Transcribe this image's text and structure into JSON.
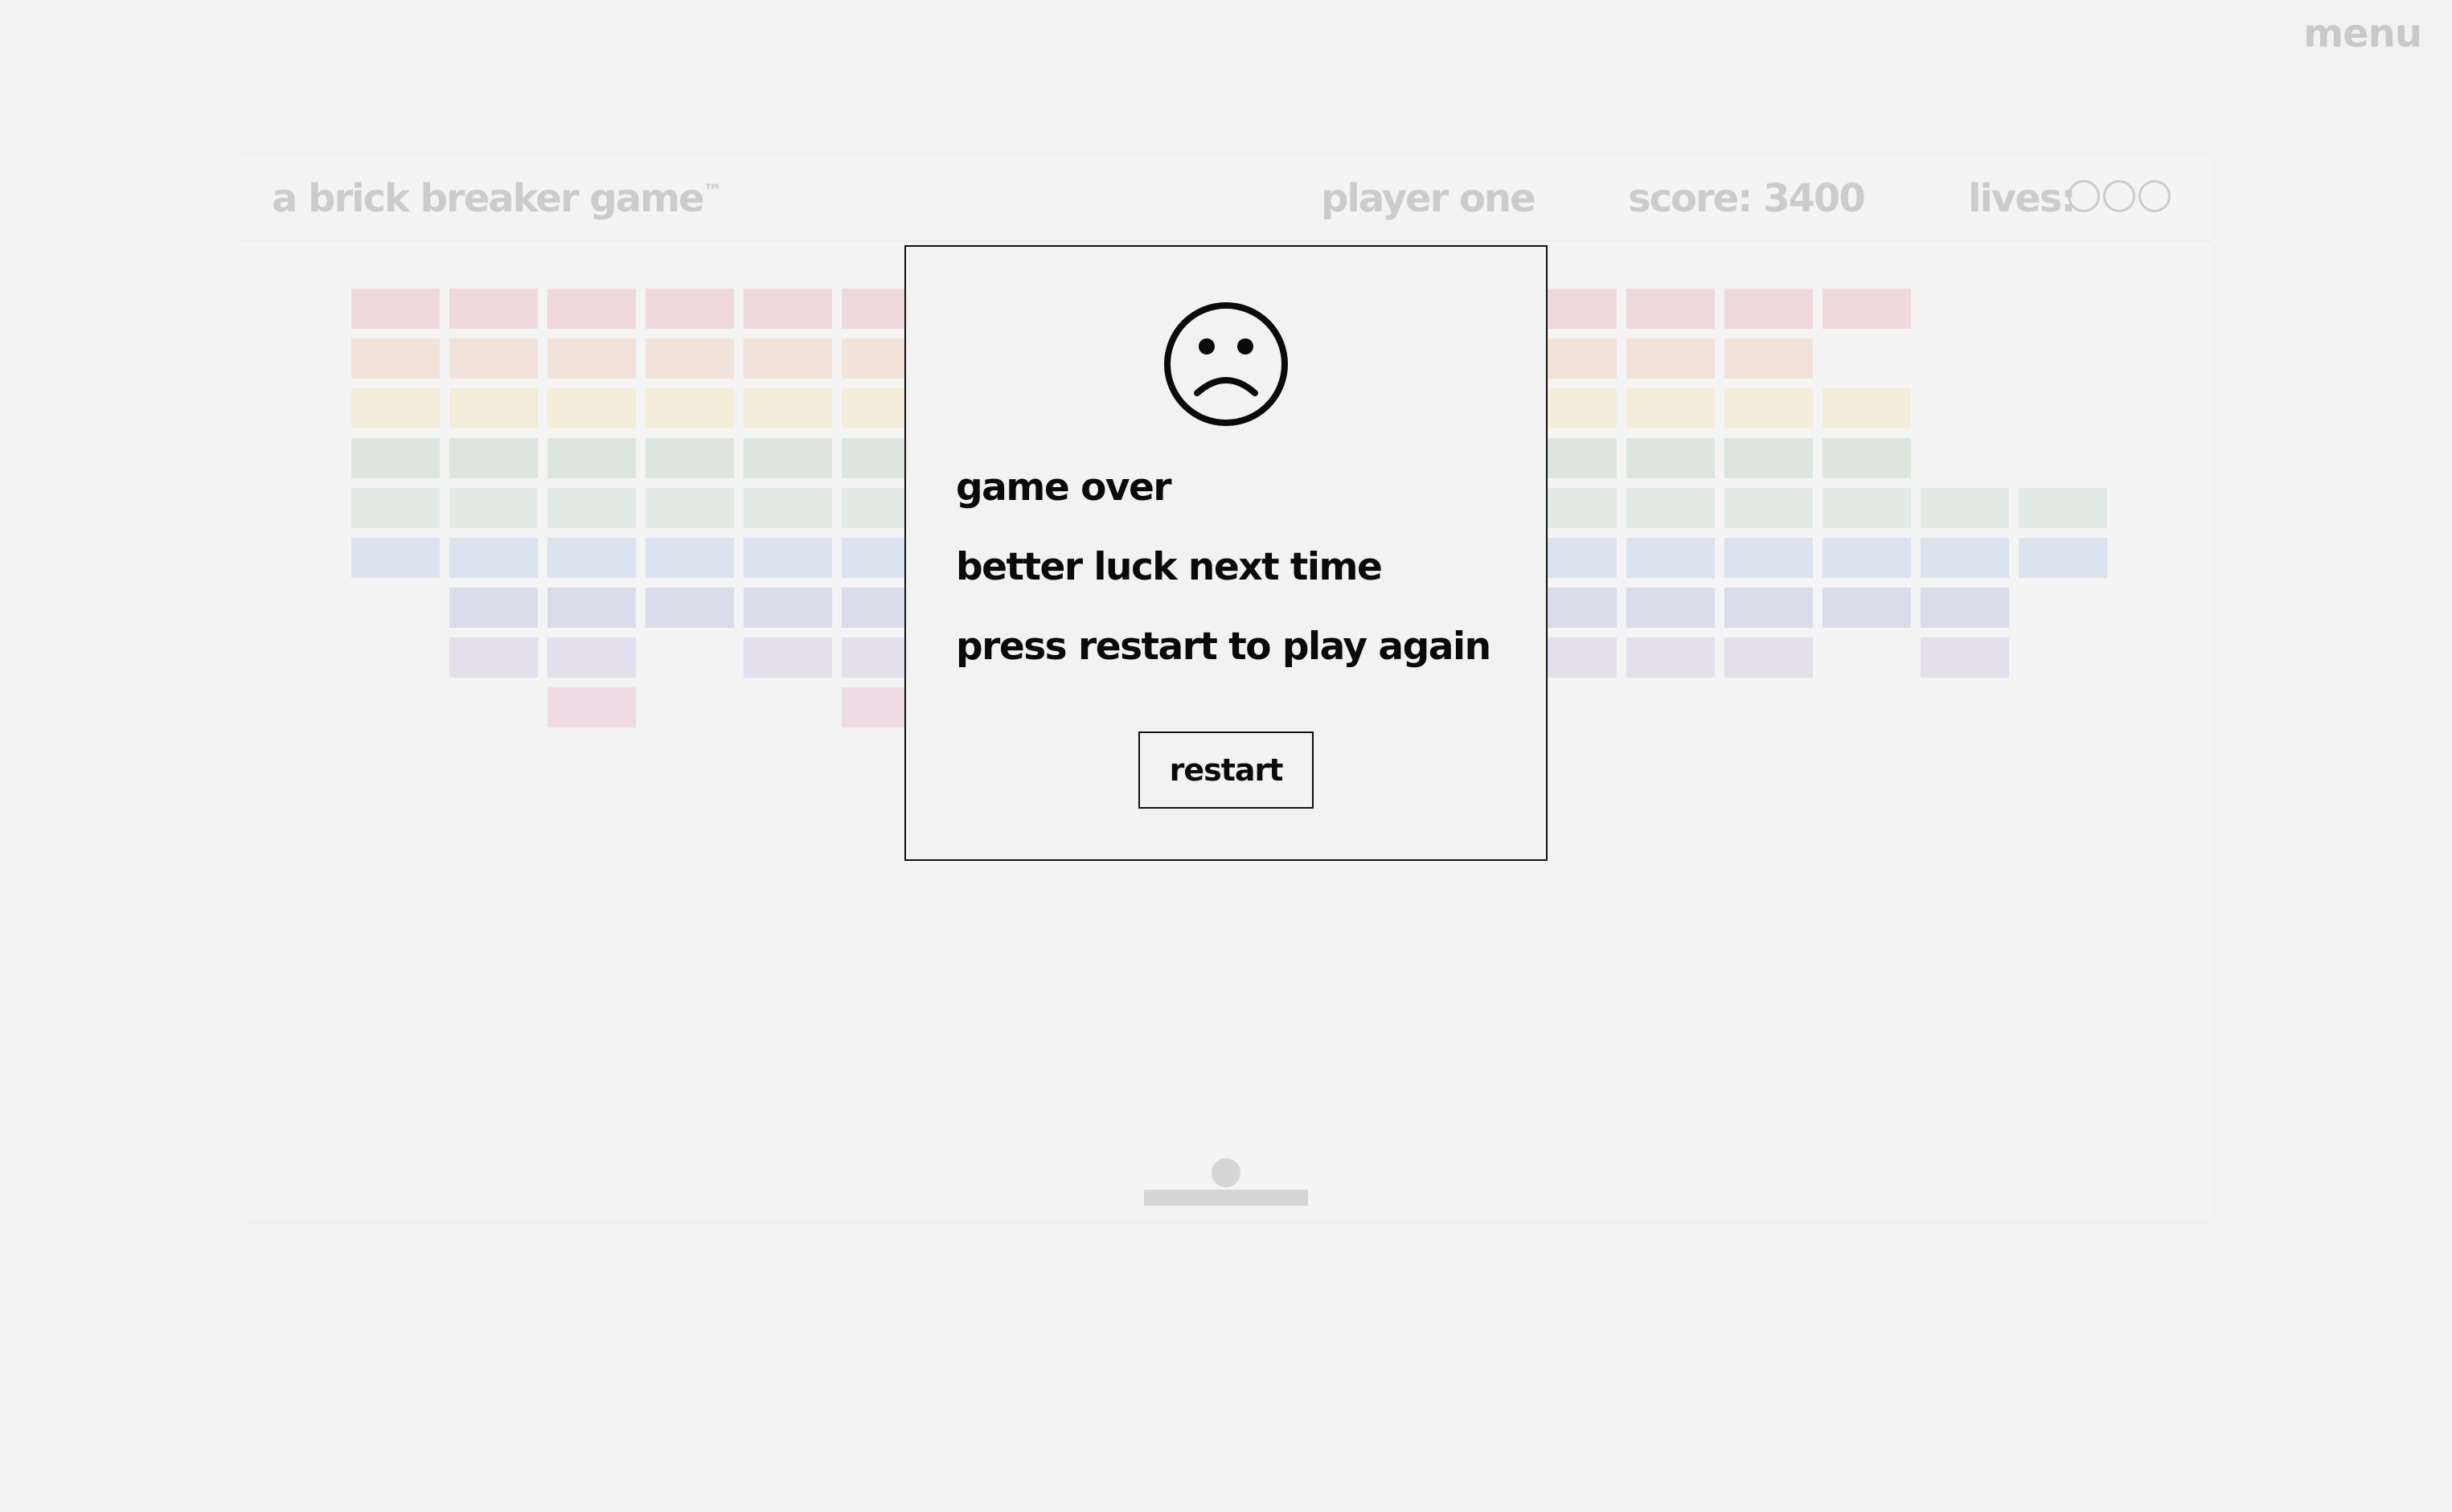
{
  "menu": {
    "label": "menu"
  },
  "header": {
    "title": "a brick breaker game",
    "trademark": "™",
    "player": "player one",
    "score": "score: 3400",
    "lives_label": "lives:",
    "lives_remaining": 0,
    "lives_total": 3
  },
  "bricks": {
    "row_colors": [
      "#efd9dc",
      "#f1e3d9",
      "#f3edd9",
      "#dde6de",
      "#e2eae6",
      "#dbe3ee",
      "#dadcea",
      "#e3dfec",
      "#efdbe4"
    ],
    "grid": [
      [
        1,
        1,
        1,
        1,
        1,
        1,
        1,
        1,
        1,
        1,
        1,
        1,
        1,
        1,
        1,
        1,
        0,
        0
      ],
      [
        1,
        1,
        1,
        1,
        1,
        1,
        1,
        1,
        1,
        1,
        1,
        1,
        1,
        1,
        1,
        0,
        0,
        0
      ],
      [
        1,
        1,
        1,
        1,
        1,
        1,
        1,
        1,
        1,
        1,
        1,
        1,
        1,
        1,
        1,
        1,
        0,
        0
      ],
      [
        1,
        1,
        1,
        1,
        1,
        1,
        1,
        1,
        1,
        1,
        1,
        1,
        1,
        1,
        1,
        1,
        0,
        0
      ],
      [
        1,
        1,
        1,
        1,
        1,
        1,
        1,
        1,
        1,
        1,
        1,
        1,
        1,
        1,
        1,
        1,
        1,
        1
      ],
      [
        1,
        1,
        1,
        1,
        1,
        1,
        1,
        1,
        1,
        1,
        1,
        1,
        1,
        1,
        1,
        1,
        1,
        1
      ],
      [
        0,
        1,
        1,
        1,
        1,
        1,
        1,
        1,
        1,
        1,
        1,
        1,
        1,
        1,
        1,
        1,
        1,
        0
      ],
      [
        0,
        1,
        1,
        0,
        1,
        1,
        1,
        1,
        1,
        1,
        1,
        1,
        1,
        1,
        1,
        0,
        1,
        0
      ],
      [
        0,
        0,
        1,
        0,
        0,
        1,
        0,
        0,
        1,
        0,
        0,
        0,
        0,
        0,
        0,
        0,
        0,
        0
      ]
    ]
  },
  "dialog": {
    "icon": "sad-face-icon",
    "line1": "game over",
    "line2": "better luck next time",
    "line3": "press restart to play again",
    "restart_label": "restart"
  }
}
